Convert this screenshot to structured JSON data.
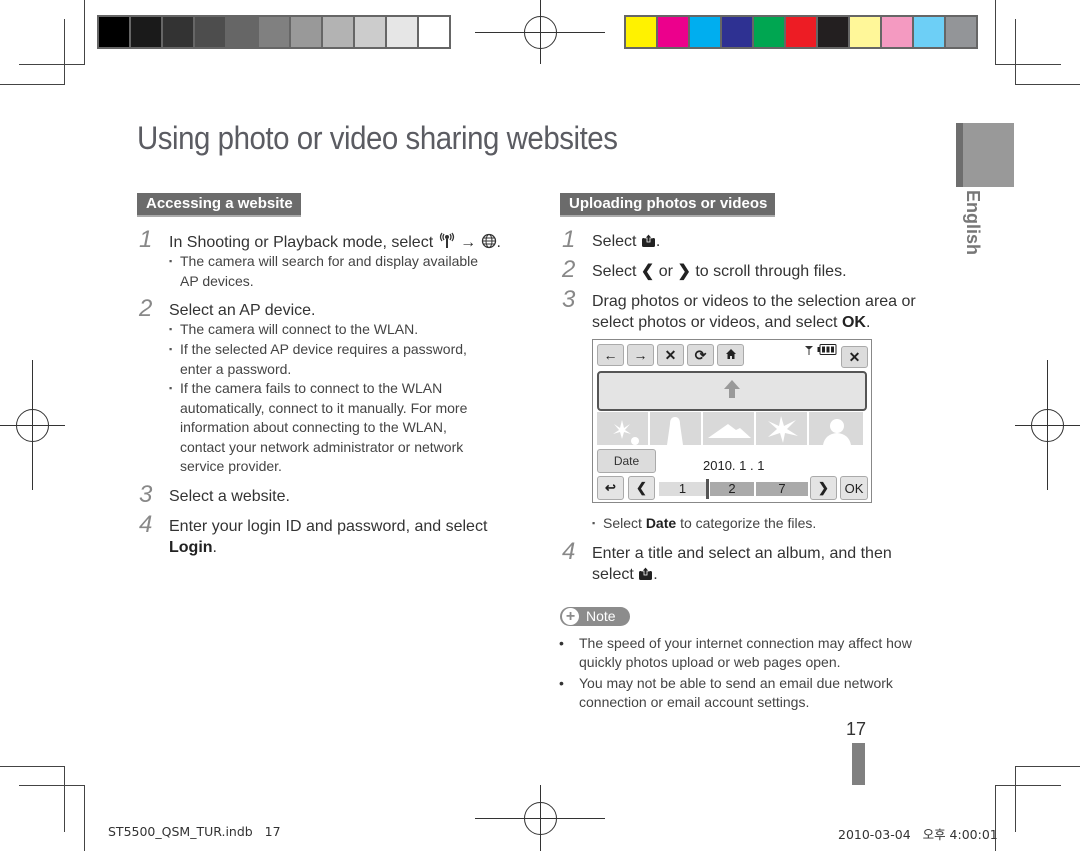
{
  "page": {
    "title": "Using photo or video sharing websites",
    "side_tab_label": "English",
    "page_number": "17",
    "footer_left": "ST5500_QSM_TUR.indb   17",
    "footer_right": "2010-03-04   오후 4:00:01"
  },
  "print_marks": {
    "grayscale_swatches": [
      "#000000",
      "#1a1a1a",
      "#333333",
      "#4d4d4d",
      "#666666",
      "#808080",
      "#999999",
      "#b3b3b3",
      "#cccccc",
      "#e6e6e6",
      "#ffffff"
    ],
    "color_swatches": [
      "#fff200",
      "#ec008c",
      "#00aeef",
      "#2e3192",
      "#00a651",
      "#ed1c24",
      "#231f20",
      "#fff799",
      "#f49ac1",
      "#6dcff6",
      "#939598"
    ]
  },
  "accessing": {
    "heading": "Accessing a website",
    "steps": [
      {
        "num": "1",
        "text_before": "In Shooting or Playback mode, select",
        "arrow": "→",
        "text_after": ".",
        "icons": [
          "wlan-icon",
          "globe-icon"
        ],
        "bullets": [
          "The camera will search for and display available",
          "AP devices."
        ]
      },
      {
        "num": "2",
        "text": "Select an AP device.",
        "bullets": [
          "The camera will connect to the WLAN.",
          "If the selected AP device requires a password,",
          "enter a password.",
          "If the camera fails to connect to the WLAN",
          "automatically, connect to it manually. For more",
          "information about connecting to the WLAN,",
          "contact your network administrator or network",
          "service provider."
        ]
      },
      {
        "num": "3",
        "text": "Select a website."
      },
      {
        "num": "4",
        "text": "Enter your login ID and password, and select",
        "bold_tail": "Login",
        "tail_punct": "."
      }
    ]
  },
  "uploading": {
    "heading": "Uploading photos or videos",
    "steps": [
      {
        "num": "1",
        "text_before": "Select",
        "text_after": "."
      },
      {
        "num": "2",
        "text_before": "Select",
        "mid": "or",
        "text_after": "to scroll through files."
      },
      {
        "num": "3",
        "line1": "Drag photos or videos to the selection area or",
        "line2": "select photos or videos, and select",
        "bold_tail": "OK",
        "tail_punct": "."
      },
      {
        "num": "4",
        "line1": "Enter a title and select an album, and then",
        "line2": "select",
        "tail_punct": "."
      }
    ],
    "bullet_before": "Select",
    "bullet_bold": "Date",
    "bullet_after": "to categorize the files."
  },
  "camera_screen": {
    "toolbar": [
      "back-arrow",
      "forward-arrow",
      "stop",
      "refresh",
      "home"
    ],
    "toolbar_glyphs": [
      "←",
      "→",
      "✕",
      "⟳",
      "⌂"
    ],
    "close_glyph": "✕",
    "date_button": "Date",
    "date_value": "2010. 1 . 1",
    "back_glyph": "↩",
    "prev_glyph": "❮",
    "next_glyph": "❯",
    "ok_label": "OK",
    "segments": [
      "1",
      "2",
      "7"
    ]
  },
  "note": {
    "label": "Note",
    "items": [
      {
        "line1": "The speed of your internet connection may affect how",
        "line2": "quickly photos upload or web pages open."
      },
      {
        "line1": "You may not be able to send an email due network",
        "line2": "connection or email account settings."
      }
    ]
  }
}
